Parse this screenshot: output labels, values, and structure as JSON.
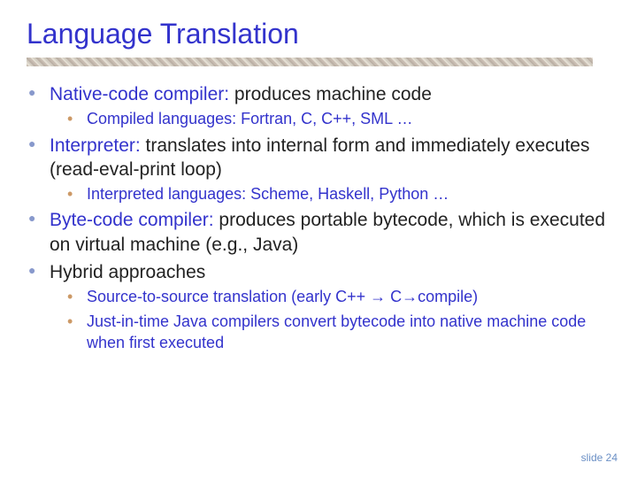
{
  "title": "Language Translation",
  "bullets": [
    {
      "term": "Native-code compiler:",
      "text": " produces machine code",
      "sub": [
        "Compiled languages: Fortran, C, C++, SML …"
      ]
    },
    {
      "term": "Interpreter:",
      "text": " translates into internal form and immediately executes (read-eval-print loop)",
      "sub": [
        "Interpreted languages: Scheme, Haskell, Python …"
      ]
    },
    {
      "term": "Byte-code compiler:",
      "text": " produces portable bytecode, which is executed on virtual machine (e.g., Java)",
      "sub": []
    },
    {
      "term": "",
      "text": "Hybrid approaches",
      "sub": [
        "Source-to-source translation (early C++ → C→compile)",
        "Just-in-time Java compilers convert bytecode into native machine code when first executed"
      ]
    }
  ],
  "footer": "slide 24"
}
